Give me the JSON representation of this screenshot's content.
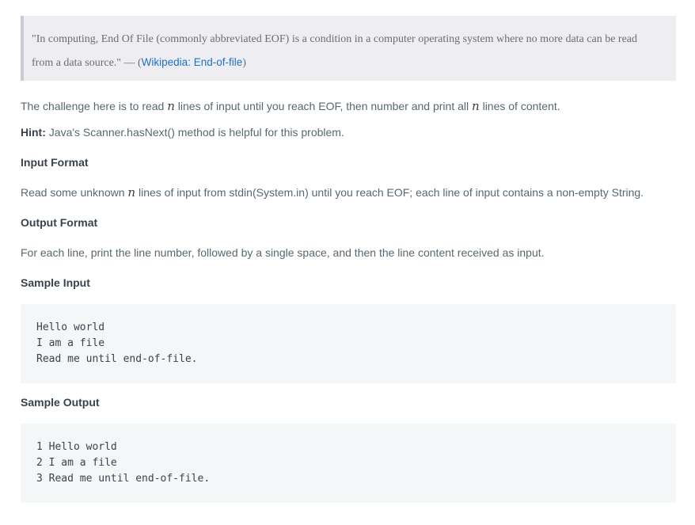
{
  "quote": {
    "text": "\"In computing, End Of File (commonly abbreviated EOF) is a condition in a computer operating system where no more data can be read from a data source.\" — (",
    "link": "Wikipedia: End-of-file",
    "close": ")"
  },
  "intro": {
    "before": "The challenge here is to read ",
    "var1": "n",
    "middle": " lines of input until you reach EOF, then number and print all ",
    "var2": "n",
    "after": " lines of content."
  },
  "hint": {
    "label": "Hint:",
    "text": " Java's Scanner.hasNext() method is helpful for this problem."
  },
  "input_format": {
    "heading": "Input Format",
    "before": "Read some unknown ",
    "var": "n",
    "after": " lines of input from stdin(System.in) until you reach EOF; each line of input contains a non-empty String."
  },
  "output_format": {
    "heading": "Output Format",
    "text": "For each line, print the line number, followed by a single space, and then the line content received as input."
  },
  "sample_input": {
    "heading": "Sample Input",
    "lines": [
      "Hello world",
      "I am a file",
      "Read me until end-of-file."
    ]
  },
  "sample_output": {
    "heading": "Sample Output",
    "lines": [
      "1 Hello world",
      "2 I am a file",
      "3 Read me until end-of-file."
    ]
  }
}
